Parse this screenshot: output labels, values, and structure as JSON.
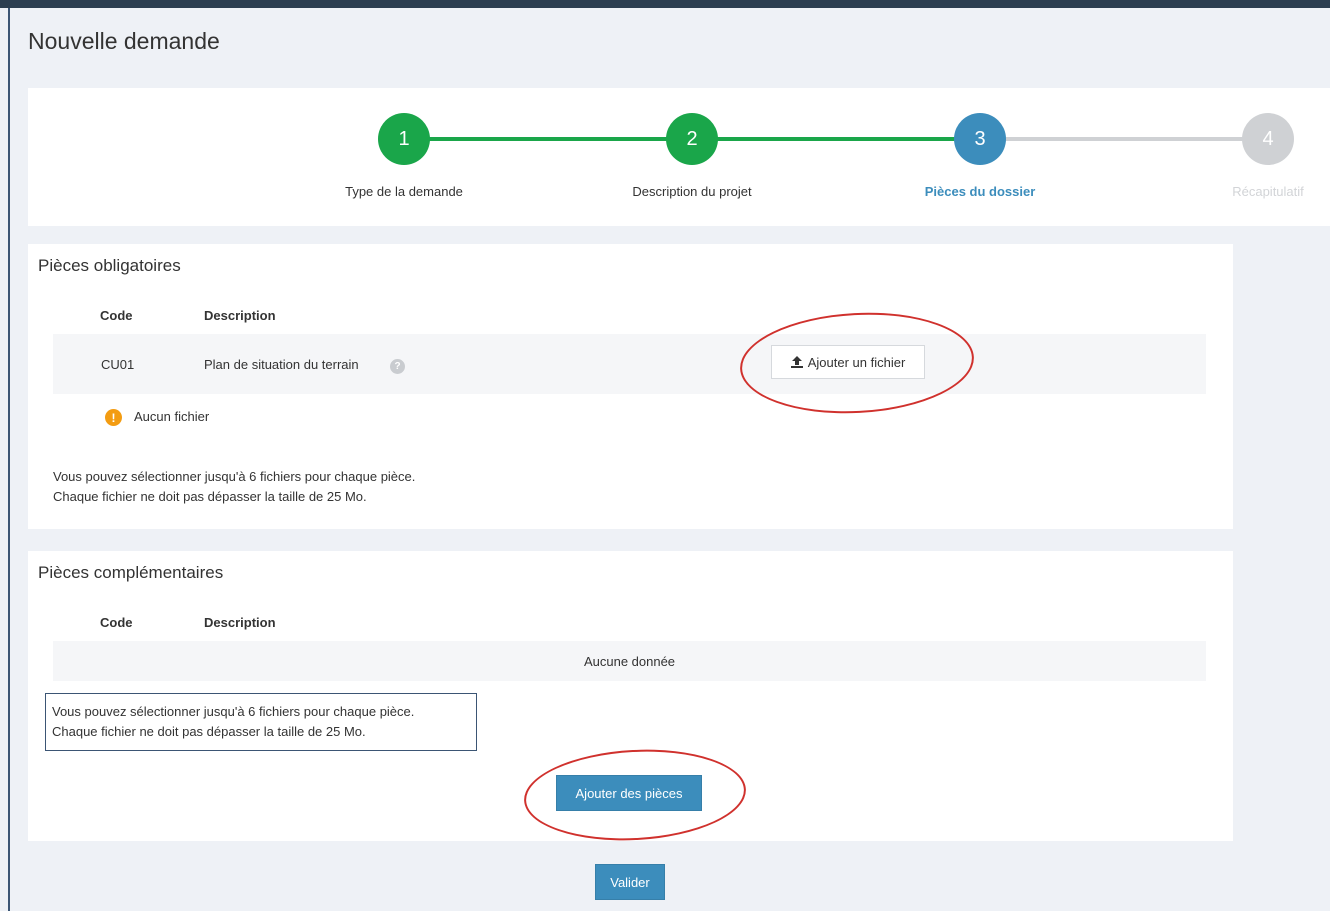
{
  "page": {
    "title": "Nouvelle demande"
  },
  "wizard": {
    "steps": [
      {
        "number": "1",
        "label": "Type de la demande",
        "state": "done"
      },
      {
        "number": "2",
        "label": "Description du projet",
        "state": "done"
      },
      {
        "number": "3",
        "label": "Pièces du dossier",
        "state": "active"
      },
      {
        "number": "4",
        "label": "Récapitulatif",
        "state": "pending"
      }
    ]
  },
  "mandatory": {
    "title": "Pièces obligatoires",
    "columns": {
      "code": "Code",
      "description": "Description"
    },
    "rows": [
      {
        "code": "CU01",
        "description": "Plan de situation du terrain",
        "help": "?",
        "add_file_label": "Ajouter un fichier"
      }
    ],
    "status_icon": "!",
    "status": "Aucun fichier",
    "info_line1": "Vous pouvez sélectionner jusqu'à 6 fichiers pour chaque pièce.",
    "info_line2": "Chaque fichier ne doit pas dépasser la taille de 25 Mo."
  },
  "complementary": {
    "title": "Pièces complémentaires",
    "columns": {
      "code": "Code",
      "description": "Description"
    },
    "empty": "Aucune donnée",
    "info_line1": "Vous pouvez sélectionner jusqu'à 6 fichiers pour chaque pièce.",
    "info_line2": "Chaque fichier ne doit pas dépasser la taille de 25 Mo.",
    "add_pieces_label": "Ajouter des pièces"
  },
  "footer": {
    "validate_label": "Valider"
  },
  "colors": {
    "step_done": "#1aa64a",
    "step_active": "#3c8dbc",
    "step_pending": "#cfd1d4",
    "primary_button": "#3c8dbc",
    "warning": "#f39c12",
    "annotation_ring": "#d0312d"
  },
  "icons": {
    "upload": "upload-icon",
    "help": "question-circle-icon",
    "warning": "exclamation-circle-icon"
  }
}
